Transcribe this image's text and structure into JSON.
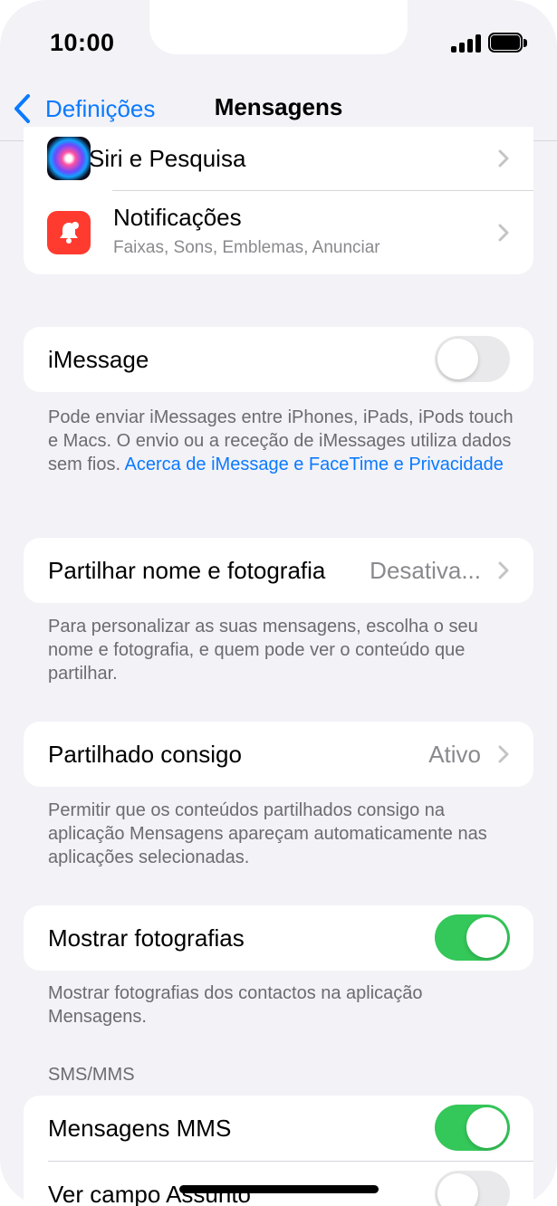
{
  "status_bar": {
    "time": "10:00"
  },
  "nav": {
    "back_label": "Definições",
    "title": "Mensagens"
  },
  "top_group": {
    "siri": {
      "label": "Siri e Pesquisa",
      "icon": "siri-icon"
    },
    "notifications": {
      "label": "Notificações",
      "subtitle": "Faixas, Sons, Emblemas, Anunciar",
      "icon": "bell-icon"
    }
  },
  "imessage": {
    "label": "iMessage",
    "enabled": false,
    "footer_text": "Pode enviar iMessages entre iPhones, iPads, iPods touch e Macs. O envio ou a receção de iMessages utiliza dados sem fios.",
    "footer_link": "Acerca de iMessage e FaceTime e Privacidade"
  },
  "share_name": {
    "label": "Partilhar nome e fotografia",
    "value": "Desativa...",
    "footer": "Para personalizar as suas mensagens, escolha o seu nome e fotografia, e quem pode ver o conteúdo que partilhar."
  },
  "shared_with_you": {
    "label": "Partilhado consigo",
    "value": "Ativo",
    "footer": "Permitir que os conteúdos partilhados consigo na aplicação Mensagens apareçam automaticamente nas aplicações selecionadas."
  },
  "show_photos": {
    "label": "Mostrar fotografias",
    "enabled": true,
    "footer": "Mostrar fotografias dos contactos na aplicação Mensagens."
  },
  "sms_mms": {
    "header": "SMS/MMS",
    "mms": {
      "label": "Mensagens MMS",
      "enabled": true
    },
    "subject": {
      "label": "Ver campo Assunto",
      "enabled": false
    }
  },
  "colors": {
    "accent": "#0a7aff",
    "toggle_on": "#34c759",
    "toggle_off": "#e9e9eb",
    "background": "#f2f2f7",
    "notification_icon": "#ff3b30"
  }
}
